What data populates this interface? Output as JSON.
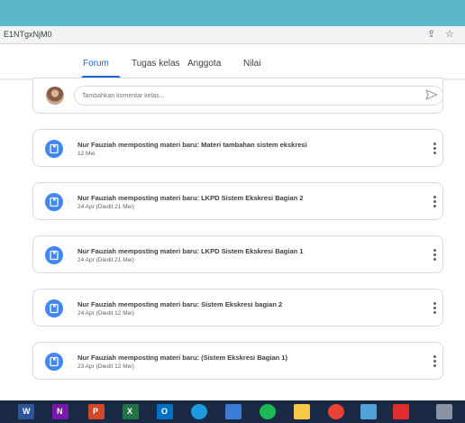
{
  "address_bar": {
    "url": "E1NTgxNjM0"
  },
  "tabs": [
    {
      "label": "Forum",
      "active": true
    },
    {
      "label": "Tugas kelas",
      "active": false
    },
    {
      "label": "Anggota",
      "active": false
    },
    {
      "label": "Nilai",
      "active": false
    }
  ],
  "comment": {
    "placeholder": "Tambahkan komentar kelas..."
  },
  "posts": [
    {
      "title": "Nur Fauziah memposting materi baru: Materi tambahan sistem ekskresi",
      "date": "12 Mei"
    },
    {
      "title": "Nur Fauziah memposting materi baru: LKPD Sistem Ekskresi Bagian 2",
      "date": "24 Apr (Diedit 21 Mei)"
    },
    {
      "title": "Nur Fauziah memposting materi baru: LKPD Sistem Ekskresi Bagian 1",
      "date": "24 Apr (Diedit 21 Mei)"
    },
    {
      "title": "Nur Fauziah memposting materi baru: Sistem Ekskresi bagian 2",
      "date": "24 Apr (Diedit 12 Mei)"
    },
    {
      "title": "Nur Fauziah memposting materi baru: (Sistem Ekskresi Bagian 1)",
      "date": "23 Apr (Diedit 12 Mei)"
    }
  ],
  "taskbar": {
    "apps": [
      {
        "icon": "word-icon",
        "glyph": "W",
        "color": "#2b579a"
      },
      {
        "icon": "onenote-icon",
        "glyph": "N",
        "color": "#7719aa"
      },
      {
        "icon": "powerpoint-icon",
        "glyph": "P",
        "color": "#d24726"
      },
      {
        "icon": "excel-icon",
        "glyph": "X",
        "color": "#217346"
      },
      {
        "icon": "outlook-icon",
        "glyph": "O",
        "color": "#0072c6"
      },
      {
        "icon": "edge-icon",
        "glyph": "",
        "color": "#1e9be0"
      },
      {
        "icon": "photos-icon",
        "glyph": "",
        "color": "#3a7bd5"
      },
      {
        "icon": "spotify-icon",
        "glyph": "",
        "color": "#1db954"
      },
      {
        "icon": "folder-icon",
        "glyph": "",
        "color": "#f7c948"
      },
      {
        "icon": "chrome-icon",
        "glyph": "",
        "color": "#ea4335"
      },
      {
        "icon": "monitor-icon",
        "glyph": "",
        "color": "#4fa3d9"
      },
      {
        "icon": "acrobat-icon",
        "glyph": "",
        "color": "#e02d2d"
      },
      {
        "icon": "keyboard-icon",
        "glyph": "",
        "color": "#8a94a6"
      }
    ]
  }
}
